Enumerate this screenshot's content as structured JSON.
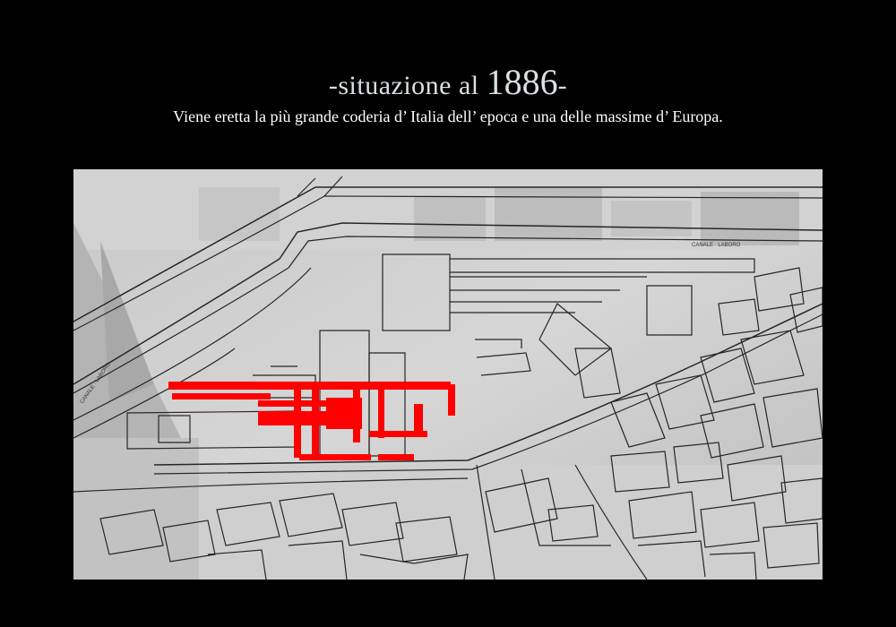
{
  "slide": {
    "title_prefix": "-situazione al ",
    "title_year": "1886",
    "title_suffix": "-",
    "subtitle": "Viene eretta la più grande coderia d’ Italia dell’ epoca e una delle massime d’ Europa."
  },
  "map": {
    "labels": [
      "CANALE · LABORO",
      "CANALE · LABORO"
    ],
    "colors": {
      "background": "#000000",
      "highlight": "#ff0000",
      "lines": "#222222"
    }
  }
}
